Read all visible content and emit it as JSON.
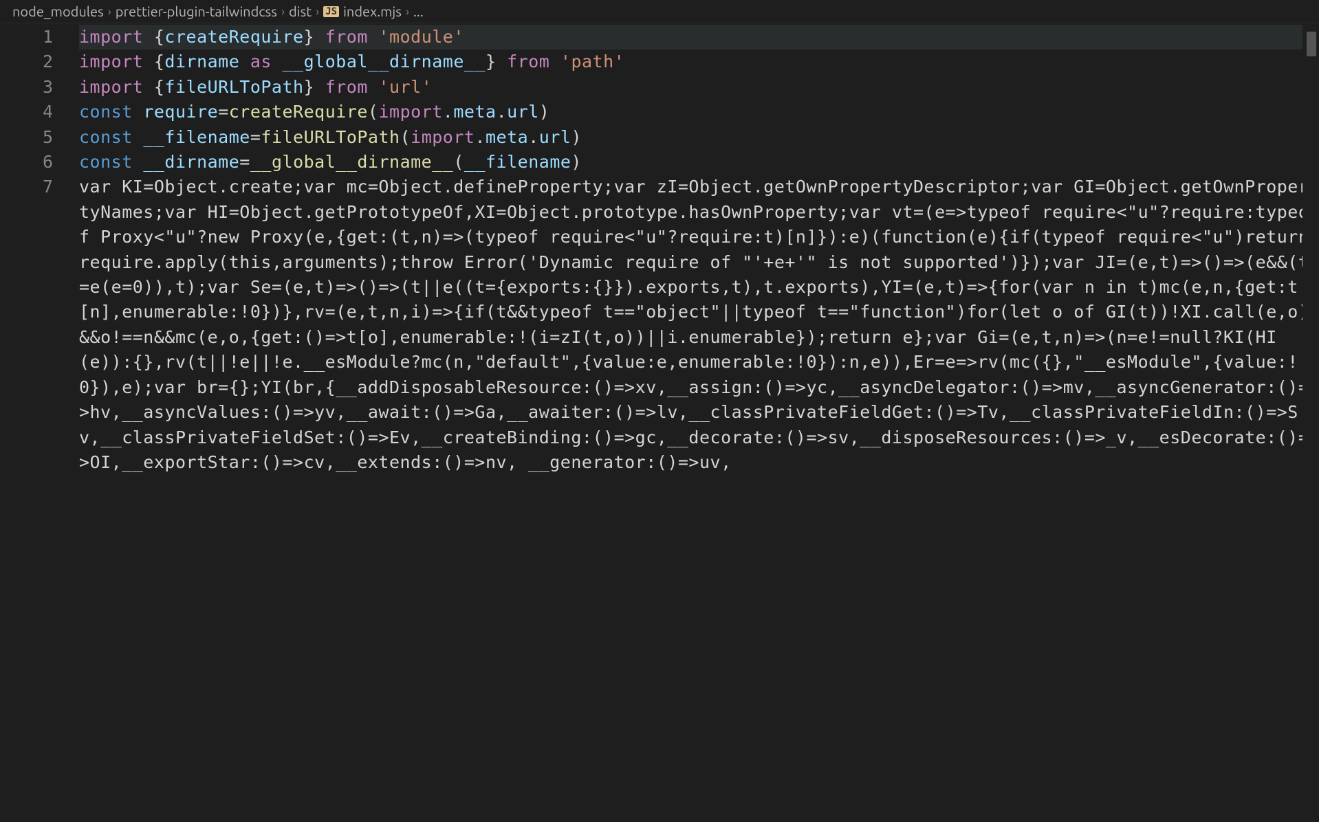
{
  "breadcrumb": {
    "items": [
      "node_modules",
      "prettier-plugin-tailwindcss",
      "dist",
      "index.mjs",
      "..."
    ],
    "file_badge": "JS"
  },
  "gutter": {
    "lines": [
      "1",
      "2",
      "3",
      "4",
      "5",
      "6",
      "7"
    ]
  },
  "code": {
    "lines": [
      {
        "highlighted": true,
        "tokens": [
          {
            "c": "tok-kw",
            "t": "import"
          },
          {
            "c": "tok-plain",
            "t": " {"
          },
          {
            "c": "tok-var",
            "t": "createRequire"
          },
          {
            "c": "tok-plain",
            "t": "} "
          },
          {
            "c": "tok-kw",
            "t": "from"
          },
          {
            "c": "tok-plain",
            "t": " "
          },
          {
            "c": "tok-str",
            "t": "'module'"
          }
        ]
      },
      {
        "tokens": [
          {
            "c": "tok-kw",
            "t": "import"
          },
          {
            "c": "tok-plain",
            "t": " {"
          },
          {
            "c": "tok-var",
            "t": "dirname"
          },
          {
            "c": "tok-plain",
            "t": " "
          },
          {
            "c": "tok-kw",
            "t": "as"
          },
          {
            "c": "tok-plain",
            "t": " "
          },
          {
            "c": "tok-var",
            "t": "__global__dirname__"
          },
          {
            "c": "tok-plain",
            "t": "} "
          },
          {
            "c": "tok-kw",
            "t": "from"
          },
          {
            "c": "tok-plain",
            "t": " "
          },
          {
            "c": "tok-str",
            "t": "'path'"
          }
        ]
      },
      {
        "tokens": [
          {
            "c": "tok-kw",
            "t": "import"
          },
          {
            "c": "tok-plain",
            "t": " {"
          },
          {
            "c": "tok-var",
            "t": "fileURLToPath"
          },
          {
            "c": "tok-plain",
            "t": "} "
          },
          {
            "c": "tok-kw",
            "t": "from"
          },
          {
            "c": "tok-plain",
            "t": " "
          },
          {
            "c": "tok-str",
            "t": "'url'"
          }
        ]
      },
      {
        "tokens": [
          {
            "c": "tok-const",
            "t": "const"
          },
          {
            "c": "tok-plain",
            "t": " "
          },
          {
            "c": "tok-var",
            "t": "require"
          },
          {
            "c": "tok-plain",
            "t": "="
          },
          {
            "c": "tok-fn",
            "t": "createRequire"
          },
          {
            "c": "tok-plain",
            "t": "("
          },
          {
            "c": "tok-kw",
            "t": "import"
          },
          {
            "c": "tok-plain",
            "t": "."
          },
          {
            "c": "tok-var",
            "t": "meta"
          },
          {
            "c": "tok-plain",
            "t": "."
          },
          {
            "c": "tok-var",
            "t": "url"
          },
          {
            "c": "tok-plain",
            "t": ")"
          }
        ]
      },
      {
        "tokens": [
          {
            "c": "tok-const",
            "t": "const"
          },
          {
            "c": "tok-plain",
            "t": " "
          },
          {
            "c": "tok-var",
            "t": "__filename"
          },
          {
            "c": "tok-plain",
            "t": "="
          },
          {
            "c": "tok-fn",
            "t": "fileURLToPath"
          },
          {
            "c": "tok-plain",
            "t": "("
          },
          {
            "c": "tok-kw",
            "t": "import"
          },
          {
            "c": "tok-plain",
            "t": "."
          },
          {
            "c": "tok-var",
            "t": "meta"
          },
          {
            "c": "tok-plain",
            "t": "."
          },
          {
            "c": "tok-var",
            "t": "url"
          },
          {
            "c": "tok-plain",
            "t": ")"
          }
        ]
      },
      {
        "tokens": [
          {
            "c": "tok-const",
            "t": "const"
          },
          {
            "c": "tok-plain",
            "t": " "
          },
          {
            "c": "tok-var",
            "t": "__dirname"
          },
          {
            "c": "tok-plain",
            "t": "="
          },
          {
            "c": "tok-fn",
            "t": "__global__dirname__"
          },
          {
            "c": "tok-plain",
            "t": "("
          },
          {
            "c": "tok-var",
            "t": "__filename"
          },
          {
            "c": "tok-plain",
            "t": ")"
          }
        ]
      },
      {
        "tokens": [
          {
            "c": "tok-plain",
            "t": "var KI=Object.create;var mc=Object.defineProperty;var zI=Object.getOwnPropertyDescriptor;var GI=Object.getOwnPropertyNames;var HI=Object.getPrototypeOf,XI=Object.prototype.hasOwnProperty;var vt=(e=>typeof require<\"u\"?require:typeof Proxy<\"u\"?new Proxy(e,{get:(t,n)=>(typeof require<\"u\"?require:t)[n]}):e)(function(e){if(typeof require<\"u\")return require.apply(this,arguments);throw Error('Dynamic require of \"'+e+'\" is not supported')});var JI=(e,t)=>()=>(e&&(t=e(e=0)),t);var Se=(e,t)=>()=>(t||e((t={exports:{}}).exports,t),t.exports),YI=(e,t)=>{for(var n in t)mc(e,n,{get:t[n],enumerable:!0})},rv=(e,t,n,i)=>{if(t&&typeof t==\"object\"||typeof t==\"function\")for(let o of GI(t))!XI.call(e,o)&&o!==n&&mc(e,o,{get:()=>t[o],enumerable:!(i=zI(t,o))||i.enumerable});return e};var Gi=(e,t,n)=>(n=e!=null?KI(HI(e)):{},rv(t||!e||!e.__esModule?mc(n,\"default\",{value:e,enumerable:!0}):n,e)),Er=e=>rv(mc({},\"__esModule\",{value:!0}),e);var br={};YI(br,{__addDisposableResource:()=>xv,__assign:()=>yc,__asyncDelegator:()=>mv,__asyncGenerator:()=>hv,__asyncValues:()=>yv,__await:()=>Ga,__awaiter:()=>lv,__classPrivateFieldGet:()=>Tv,__classPrivateFieldIn:()=>Sv,__classPrivateFieldSet:()=>Ev,__createBinding:()=>gc,__decorate:()=>sv,__disposeResources:()=>_v,__esDecorate:()=>OI,__exportStar:()=>cv,__extends:()=>nv, __generator:()=>uv,"
          }
        ]
      }
    ]
  }
}
